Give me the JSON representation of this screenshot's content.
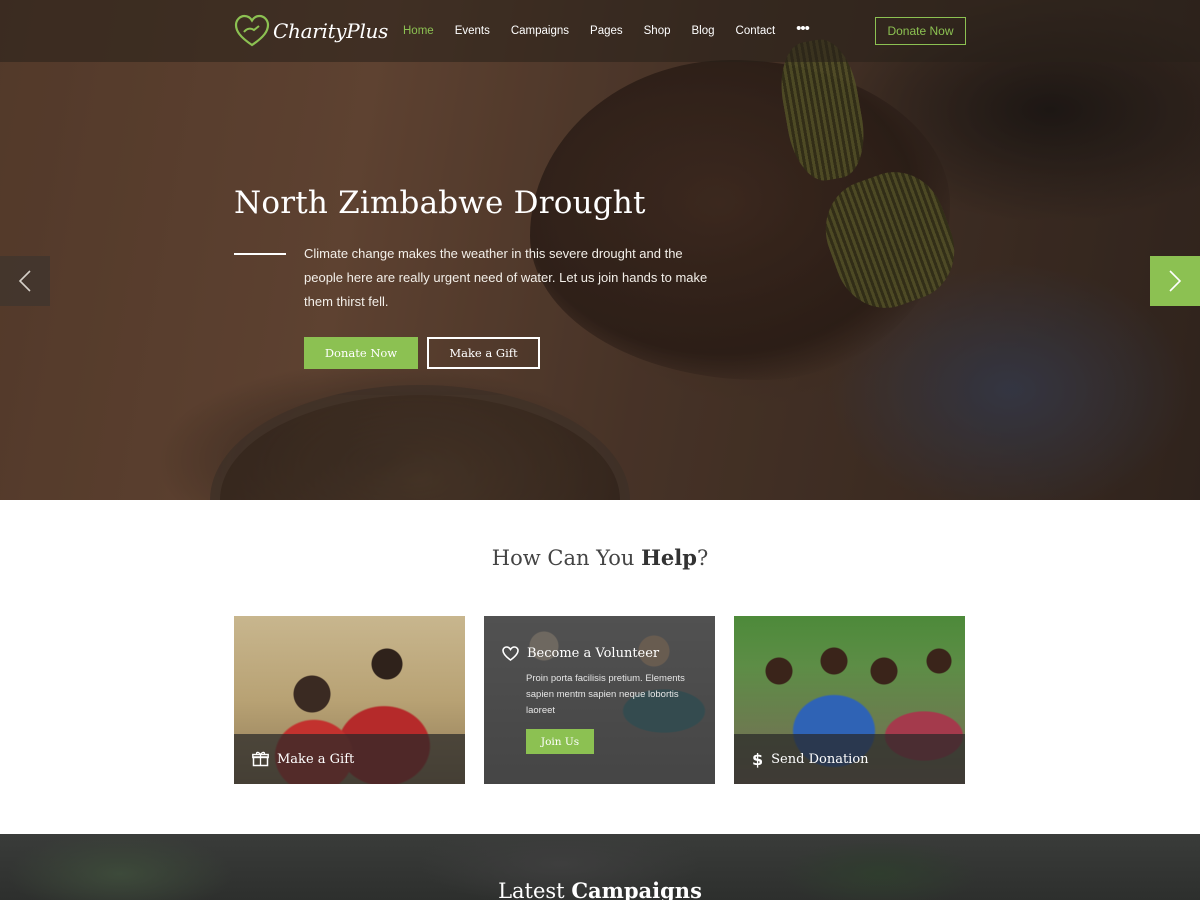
{
  "brand": {
    "name": "CharityPlus",
    "accent": "#8cc152"
  },
  "nav": {
    "items": [
      "Home",
      "Events",
      "Campaigns",
      "Pages",
      "Shop",
      "Blog",
      "Contact"
    ],
    "active": "Home",
    "more_icon": "more-dots-icon",
    "cta_label": "Donate Now"
  },
  "hero": {
    "title": "North Zimbabwe Drought",
    "text": "Climate change makes the weather in this severe drought and the people here are really urgent need of water. Let us join hands to make them thirst fell.",
    "primary_button": "Donate Now",
    "secondary_button": "Make a Gift",
    "prev_icon": "chevron-left-icon",
    "next_icon": "chevron-right-icon"
  },
  "help": {
    "title_light": "How Can You ",
    "title_bold": "Help",
    "title_end": "?",
    "cards": [
      {
        "label": "Make  a Gift",
        "icon": "gift-icon"
      },
      {
        "label": "Become a Volunteer",
        "icon": "heart-icon",
        "text": "Proin porta facilisis pretium. Elements sapien  mentm sapien neque lobortis laoreet",
        "button": "Join Us"
      },
      {
        "label": "Send Donation",
        "icon": "dollar-icon"
      }
    ]
  },
  "campaigns": {
    "title_light": "Latest ",
    "title_bold": "Campaigns"
  }
}
